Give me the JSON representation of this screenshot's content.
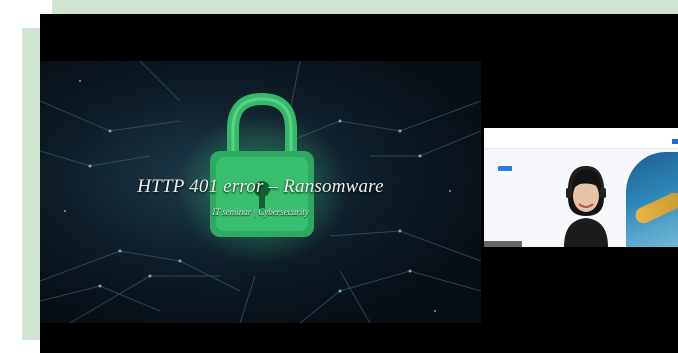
{
  "slide": {
    "title": "HTTP 401 error – Ransomware",
    "subtitle": "IT seminar | Cybersecurity"
  },
  "colors": {
    "frame_accent": "#cfe5d1",
    "screen_background": "#000000",
    "lock_green": "#3ecf7a"
  },
  "icons": {
    "slide_graphic": "padlock-icon"
  }
}
